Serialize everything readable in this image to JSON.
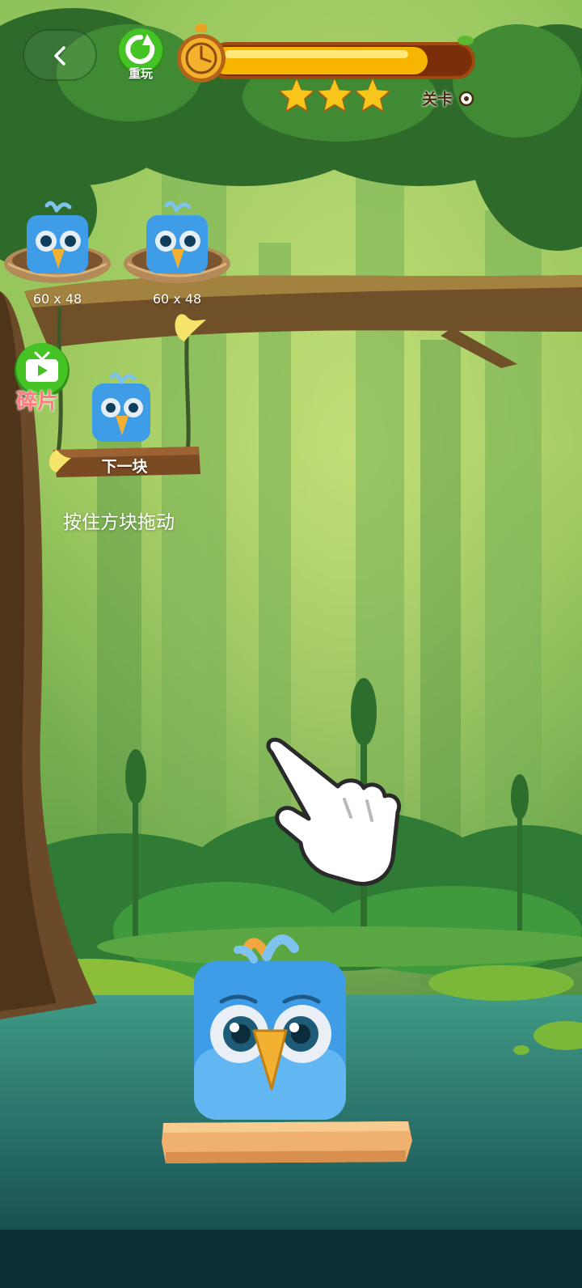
{
  "header": {
    "back_icon": "chevron-left-icon",
    "replay_label": "重玩",
    "replay_icon": "refresh-icon",
    "timer_icon": "stopwatch-icon",
    "timer_progress": 0.83,
    "stars_earned": 3,
    "level_label": "关卡"
  },
  "nests": [
    {
      "size_label": "60 x 48"
    },
    {
      "size_label": "60 x 48"
    }
  ],
  "fragments": {
    "label": "碎片",
    "icon": "tv-icon"
  },
  "next_block": {
    "label": "下一块"
  },
  "hint": {
    "text": "按住方块拖动"
  },
  "colors": {
    "bird_blue": "#3f9de8",
    "beak": "#f3b132",
    "bar_fill": "#f7b500",
    "button_green": "#3fb420",
    "wood": "#f0b070"
  }
}
